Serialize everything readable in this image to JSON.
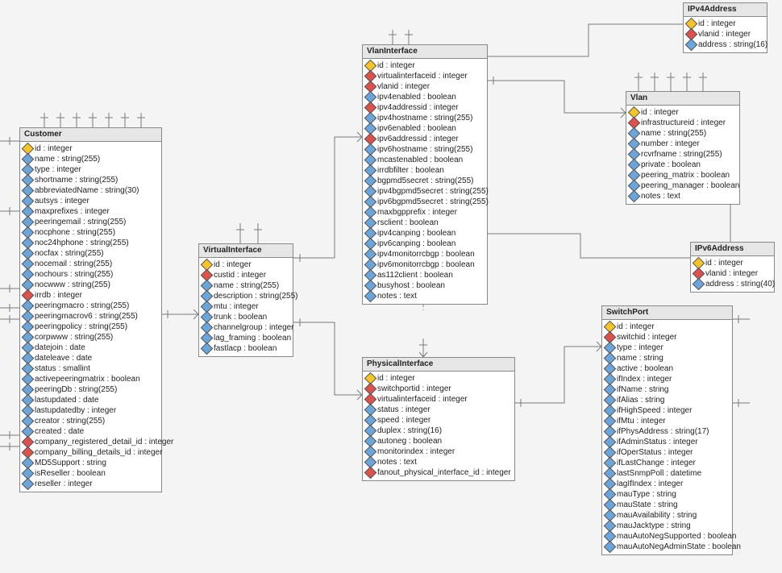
{
  "entities": {
    "customer": {
      "title": "Customer",
      "attributes": [
        {
          "kind": "pk",
          "text": "id : integer"
        },
        {
          "kind": "col",
          "text": "name : string(255)"
        },
        {
          "kind": "col",
          "text": "type : integer"
        },
        {
          "kind": "col",
          "text": "shortname : string(255)"
        },
        {
          "kind": "col",
          "text": "abbreviatedName : string(30)"
        },
        {
          "kind": "col",
          "text": "autsys : integer"
        },
        {
          "kind": "col",
          "text": "maxprefixes : integer"
        },
        {
          "kind": "col",
          "text": "peeringemail : string(255)"
        },
        {
          "kind": "col",
          "text": "nocphone : string(255)"
        },
        {
          "kind": "col",
          "text": "noc24hphone : string(255)"
        },
        {
          "kind": "col",
          "text": "nocfax : string(255)"
        },
        {
          "kind": "col",
          "text": "nocemail : string(255)"
        },
        {
          "kind": "col",
          "text": "nochours : string(255)"
        },
        {
          "kind": "col",
          "text": "nocwww : string(255)"
        },
        {
          "kind": "fk",
          "text": "irrdb : integer"
        },
        {
          "kind": "col",
          "text": "peeringmacro : string(255)"
        },
        {
          "kind": "col",
          "text": "peeringmacrov6 : string(255)"
        },
        {
          "kind": "col",
          "text": "peeringpolicy : string(255)"
        },
        {
          "kind": "col",
          "text": "corpwww : string(255)"
        },
        {
          "kind": "col",
          "text": "datejoin : date"
        },
        {
          "kind": "col",
          "text": "dateleave : date"
        },
        {
          "kind": "col",
          "text": "status : smallint"
        },
        {
          "kind": "col",
          "text": "activepeeringmatrix : boolean"
        },
        {
          "kind": "col",
          "text": "peeringDb : string(255)"
        },
        {
          "kind": "col",
          "text": "lastupdated : date"
        },
        {
          "kind": "col",
          "text": "lastupdatedby : integer"
        },
        {
          "kind": "col",
          "text": "creator : string(255)"
        },
        {
          "kind": "col",
          "text": "created : date"
        },
        {
          "kind": "fk",
          "text": "company_registered_detail_id : integer"
        },
        {
          "kind": "fk",
          "text": "company_billing_details_id : integer"
        },
        {
          "kind": "col",
          "text": "MD5Support : string"
        },
        {
          "kind": "col",
          "text": "isReseller : boolean"
        },
        {
          "kind": "col",
          "text": "reseller : integer"
        }
      ]
    },
    "virtualinterface": {
      "title": "VirtualInterface",
      "attributes": [
        {
          "kind": "pk",
          "text": "id : integer"
        },
        {
          "kind": "fk",
          "text": "custid : integer"
        },
        {
          "kind": "col",
          "text": "name : string(255)"
        },
        {
          "kind": "col",
          "text": "description : string(255)"
        },
        {
          "kind": "col",
          "text": "mtu : integer"
        },
        {
          "kind": "col",
          "text": "trunk : boolean"
        },
        {
          "kind": "col",
          "text": "channelgroup : integer"
        },
        {
          "kind": "col",
          "text": "lag_framing : boolean"
        },
        {
          "kind": "col",
          "text": "fastlacp : boolean"
        }
      ]
    },
    "vlaninterface": {
      "title": "VlanInterface",
      "attributes": [
        {
          "kind": "pk",
          "text": "id : integer"
        },
        {
          "kind": "fk",
          "text": "virtualinterfaceid : integer"
        },
        {
          "kind": "fk",
          "text": "vlanid : integer"
        },
        {
          "kind": "col",
          "text": "ipv4enabled : boolean"
        },
        {
          "kind": "fk",
          "text": "ipv4addressid : integer"
        },
        {
          "kind": "col",
          "text": "ipv4hostname : string(255)"
        },
        {
          "kind": "col",
          "text": "ipv6enabled : boolean"
        },
        {
          "kind": "fk",
          "text": "ipv6addressid : integer"
        },
        {
          "kind": "col",
          "text": "ipv6hostname : string(255)"
        },
        {
          "kind": "col",
          "text": "mcastenabled : boolean"
        },
        {
          "kind": "col",
          "text": "irrdbfilter : boolean"
        },
        {
          "kind": "col",
          "text": "bgpmd5secret : string(255)"
        },
        {
          "kind": "col",
          "text": "ipv4bgpmd5secret : string(255)"
        },
        {
          "kind": "col",
          "text": "ipv6bgpmd5secret : string(255)"
        },
        {
          "kind": "col",
          "text": "maxbgpprefix : integer"
        },
        {
          "kind": "col",
          "text": "rsclient : boolean"
        },
        {
          "kind": "col",
          "text": "ipv4canping : boolean"
        },
        {
          "kind": "col",
          "text": "ipv6canping : boolean"
        },
        {
          "kind": "col",
          "text": "ipv4monitorrcbgp : boolean"
        },
        {
          "kind": "col",
          "text": "ipv6monitorrcbgp : boolean"
        },
        {
          "kind": "col",
          "text": "as112client : boolean"
        },
        {
          "kind": "col",
          "text": "busyhost : boolean"
        },
        {
          "kind": "col",
          "text": "notes : text"
        }
      ]
    },
    "physicalinterface": {
      "title": "PhysicalInterface",
      "attributes": [
        {
          "kind": "pk",
          "text": "id : integer"
        },
        {
          "kind": "fk",
          "text": "switchportid : integer"
        },
        {
          "kind": "fk",
          "text": "virtualinterfaceid : integer"
        },
        {
          "kind": "col",
          "text": "status : integer"
        },
        {
          "kind": "col",
          "text": "speed : integer"
        },
        {
          "kind": "col",
          "text": "duplex : string(16)"
        },
        {
          "kind": "col",
          "text": "autoneg : boolean"
        },
        {
          "kind": "col",
          "text": "monitorindex : integer"
        },
        {
          "kind": "col",
          "text": "notes : text"
        },
        {
          "kind": "fk",
          "text": "fanout_physical_interface_id : integer"
        }
      ]
    },
    "switchport": {
      "title": "SwitchPort",
      "attributes": [
        {
          "kind": "pk",
          "text": "id : integer"
        },
        {
          "kind": "fk",
          "text": "switchid : integer"
        },
        {
          "kind": "col",
          "text": "type : integer"
        },
        {
          "kind": "col",
          "text": "name : string"
        },
        {
          "kind": "col",
          "text": "active : boolean"
        },
        {
          "kind": "col",
          "text": "ifIndex : integer"
        },
        {
          "kind": "col",
          "text": "ifName : string"
        },
        {
          "kind": "col",
          "text": "ifAlias : string"
        },
        {
          "kind": "col",
          "text": "ifHighSpeed : integer"
        },
        {
          "kind": "col",
          "text": "ifMtu : integer"
        },
        {
          "kind": "col",
          "text": "ifPhysAddress : string(17)"
        },
        {
          "kind": "col",
          "text": "ifAdminStatus : integer"
        },
        {
          "kind": "col",
          "text": "ifOperStatus : integer"
        },
        {
          "kind": "col",
          "text": "ifLastChange : integer"
        },
        {
          "kind": "col",
          "text": "lastSnmpPoll : datetime"
        },
        {
          "kind": "col",
          "text": "lagIfIndex : integer"
        },
        {
          "kind": "col",
          "text": "mauType : string"
        },
        {
          "kind": "col",
          "text": "mauState : string"
        },
        {
          "kind": "col",
          "text": "mauAvailability : string"
        },
        {
          "kind": "col",
          "text": "mauJacktype : string"
        },
        {
          "kind": "col",
          "text": "mauAutoNegSupported : boolean"
        },
        {
          "kind": "col",
          "text": "mauAutoNegAdminState : boolean"
        }
      ]
    },
    "vlan": {
      "title": "Vlan",
      "attributes": [
        {
          "kind": "pk",
          "text": "id : integer"
        },
        {
          "kind": "fk",
          "text": "infrastructureid : integer"
        },
        {
          "kind": "col",
          "text": "name : string(255)"
        },
        {
          "kind": "col",
          "text": "number : integer"
        },
        {
          "kind": "col",
          "text": "rcvrfname : string(255)"
        },
        {
          "kind": "col",
          "text": "private : boolean"
        },
        {
          "kind": "col",
          "text": "peering_matrix : boolean"
        },
        {
          "kind": "col",
          "text": "peering_manager : boolean"
        },
        {
          "kind": "col",
          "text": "notes : text"
        }
      ]
    },
    "ipv4address": {
      "title": "IPv4Address",
      "attributes": [
        {
          "kind": "pk",
          "text": "id : integer"
        },
        {
          "kind": "fk",
          "text": "vlanid : integer"
        },
        {
          "kind": "col",
          "text": "address : string(16)"
        }
      ]
    },
    "ipv6address": {
      "title": "IPv6Address",
      "attributes": [
        {
          "kind": "pk",
          "text": "id : integer"
        },
        {
          "kind": "fk",
          "text": "vlanid : integer"
        },
        {
          "kind": "col",
          "text": "address : string(40)"
        }
      ]
    }
  }
}
